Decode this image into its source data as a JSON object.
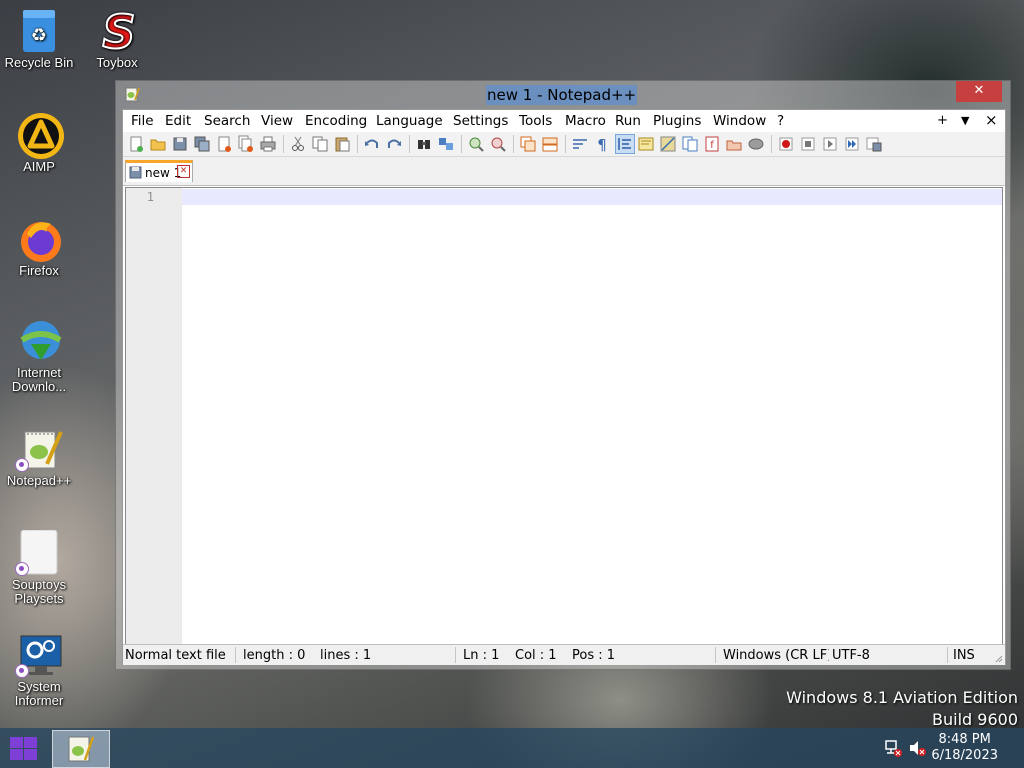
{
  "desktop": {
    "icons": [
      {
        "label": "Recycle Bin"
      },
      {
        "label": "Toybox"
      },
      {
        "label": "AIMP"
      },
      {
        "label": "Firefox"
      },
      {
        "label": "Internet Downlo..."
      },
      {
        "label": "Notepad++"
      },
      {
        "label": "Souptoys Playsets"
      },
      {
        "label": "System Informer"
      }
    ],
    "watermark": {
      "line1": "Windows 8.1 Aviation Edition",
      "line2": "Build 9600"
    }
  },
  "window": {
    "title": "new 1 - Notepad++",
    "close_glyph": "✕",
    "menu": [
      "File",
      "Edit",
      "Search",
      "View",
      "Encoding",
      "Language",
      "Settings",
      "Tools",
      "Macro",
      "Run",
      "Plugins",
      "Window",
      "?"
    ],
    "menu_right": {
      "plus": "+",
      "down": "▼",
      "close": "×"
    },
    "tab": {
      "label": "new 1",
      "close_glyph": "✕"
    },
    "editor": {
      "line_number": "1",
      "content": ""
    },
    "status": {
      "file_type": "Normal text file",
      "length": "length : 0",
      "lines": "lines : 1",
      "ln": "Ln : 1",
      "col": "Col : 1",
      "pos": "Pos : 1",
      "eol": "Windows (CR LF)",
      "encoding": "UTF-8",
      "mode": "INS"
    }
  },
  "taskbar": {
    "time": "8:48 PM",
    "date": "6/18/2023"
  },
  "colors": {
    "accent_title_selection": "#6b8fbf",
    "close_button": "#c74040",
    "tab_accent": "#f8a52c",
    "start_logo": "#7e3fd6"
  }
}
